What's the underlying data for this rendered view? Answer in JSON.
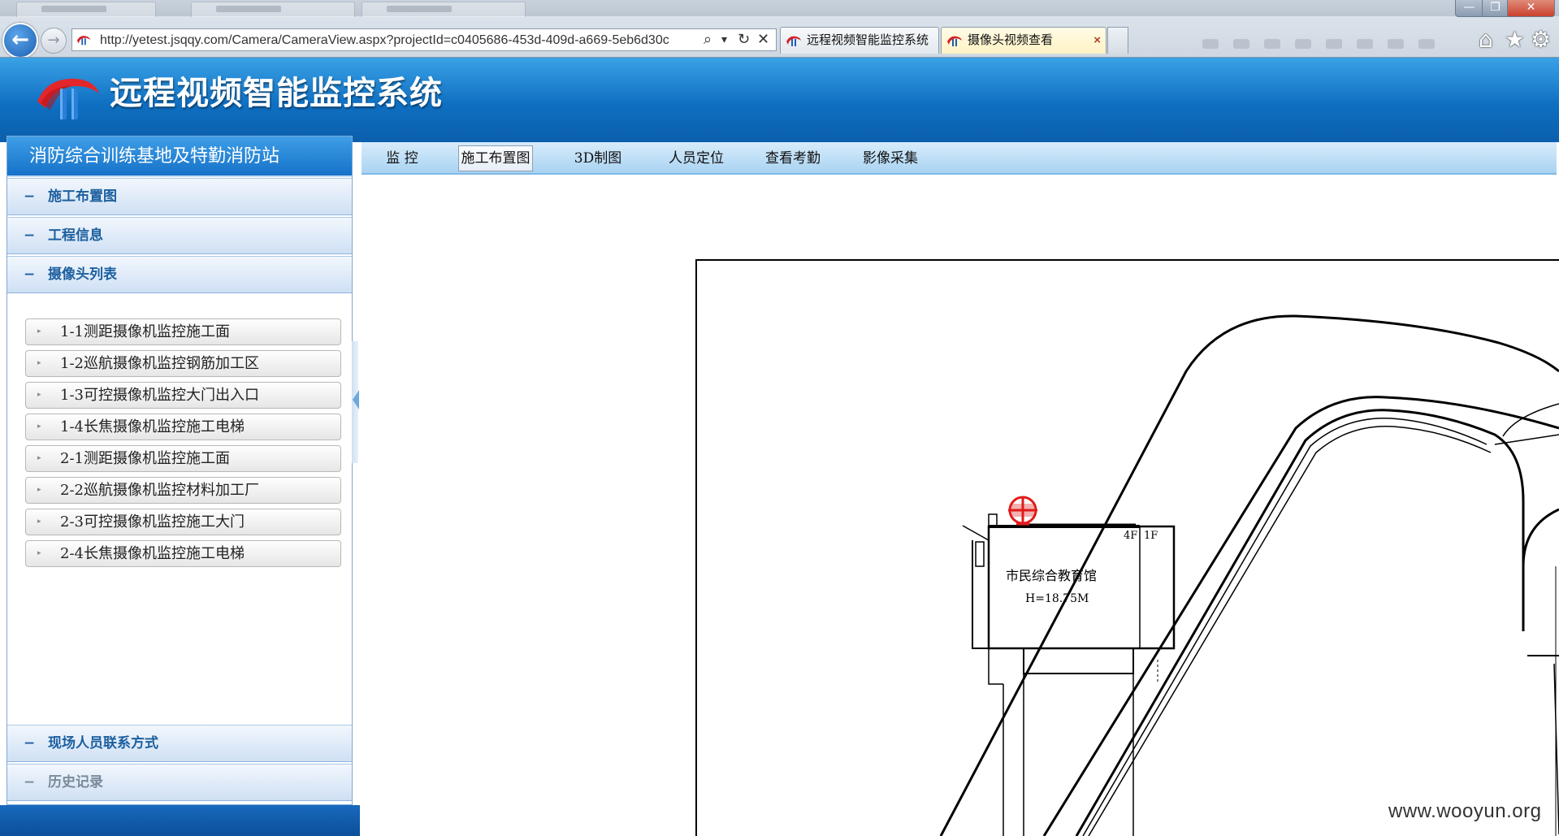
{
  "browser": {
    "url": "http://yetest.jsqqy.com/Camera/CameraView.aspx?projectId=c0405686-453d-409d-a669-5eb6d30c",
    "window_buttons": {
      "minimize": "—",
      "maximize": "❐",
      "close": "✕"
    },
    "tabs": [
      {
        "label": "远程视频智能监控系统",
        "active": false
      },
      {
        "label": "摄像头视频查看",
        "active": true
      }
    ],
    "tab_close_glyph": "×",
    "icons": {
      "back": "←",
      "forward": "→",
      "search": "⌕",
      "dropdown": "▾",
      "refresh": "↻",
      "stop": "✕",
      "home": "⌂",
      "favorites": "★",
      "tools": "⚙"
    }
  },
  "app": {
    "title": "远程视频智能监控系统",
    "colors": {
      "header": "#1677cc",
      "accent": "#1c5f9f",
      "marker": "#e01b1b"
    }
  },
  "sidebar": {
    "site_name": "消防综合训练基地及特勤消防站",
    "sections": [
      {
        "label": "施工布置图",
        "symbol": "−"
      },
      {
        "label": "工程信息",
        "symbol": "−"
      },
      {
        "label": "摄像头列表",
        "symbol": "−"
      }
    ],
    "cameras": [
      "1-1测距摄像机监控施工面",
      "1-2巡航摄像机监控钢筋加工区",
      "1-3可控摄像机监控大门出入口",
      "1-4长焦摄像机监控施工电梯",
      "2-1测距摄像机监控施工面",
      "2-2巡航摄像机监控材料加工厂",
      "2-3可控摄像机监控施工大门",
      "2-4长焦摄像机监控施工电梯"
    ],
    "bottom_sections": [
      {
        "label": "现场人员联系方式",
        "symbol": "−"
      },
      {
        "label": "历史记录",
        "symbol": "−"
      }
    ]
  },
  "main_tabs": [
    {
      "label": "监 控",
      "active": false
    },
    {
      "label": "施工布置图",
      "active": true
    },
    {
      "label": "3D制图",
      "active": false
    },
    {
      "label": "人员定位",
      "active": false
    },
    {
      "label": "查看考勤",
      "active": false
    },
    {
      "label": "影像采集",
      "active": false
    }
  ],
  "drawing": {
    "building_name": "市民综合教育馆",
    "building_height": "H=18.75M",
    "floor_label_a": "4F",
    "floor_label_b": "1F"
  },
  "watermark": "www.wooyun.org"
}
